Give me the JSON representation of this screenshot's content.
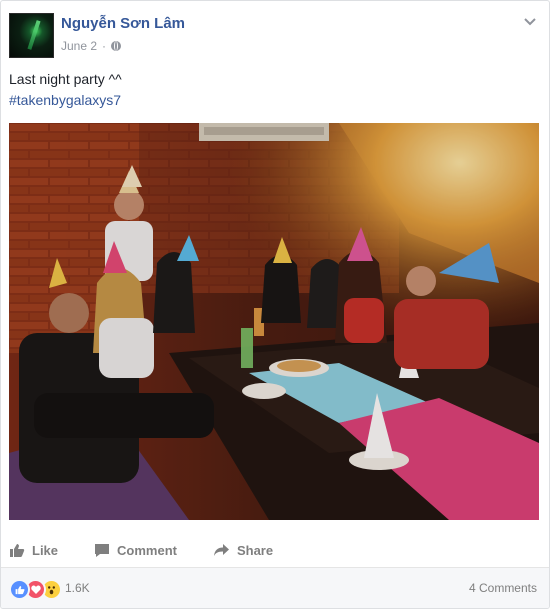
{
  "post": {
    "author": "Nguyễn Sơn Lâm",
    "date": "June 2",
    "privacy_icon": "globe-icon",
    "text_line": "Last night party ^^",
    "hashtag": "#takenbygalaxys7"
  },
  "actions": {
    "like": "Like",
    "comment": "Comment",
    "share": "Share"
  },
  "reactions": {
    "types": [
      "like-icon",
      "love-icon",
      "wow-icon"
    ],
    "count": "1.6K",
    "comments": "4 Comments"
  },
  "colors": {
    "link": "#365899",
    "meta": "#90949c",
    "action": "#7f7f7f",
    "like": "#5890ff",
    "love": "#f25268",
    "wow": "#fcd03f"
  }
}
